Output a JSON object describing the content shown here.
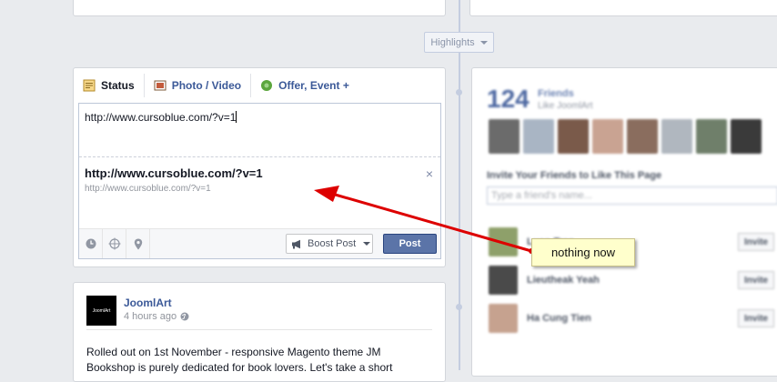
{
  "highlights": {
    "label": "Highlights"
  },
  "composer": {
    "tabs": [
      {
        "label": "Status",
        "icon": "status-icon"
      },
      {
        "label": "Photo / Video",
        "icon": "camera-icon"
      },
      {
        "label": "Offer, Event +",
        "icon": "offer-icon"
      }
    ],
    "input_value": "http://www.cursoblue.com/?v=1",
    "preview": {
      "title": "http://www.cursoblue.com/?v=1",
      "url": "http://www.cursoblue.com/?v=1",
      "close": "×"
    },
    "toolbar": {
      "icons": [
        "clock-icon",
        "target-icon",
        "location-pin-icon"
      ],
      "boost_label": "Boost Post",
      "post_label": "Post"
    }
  },
  "post": {
    "author": "JoomlArt",
    "time": "4 hours ago",
    "logo_text": "JoomlArt",
    "text": "Rolled out on 1st November - responsive Magento theme JM Bookshop is purely dedicated for book lovers. Let's take a short"
  },
  "sidebar": {
    "friends_count": "124",
    "friends_label": "Friends",
    "friends_sub": "Like JoomlArt",
    "invite_title": "Invite Your Friends to Like This Page",
    "invite_placeholder": "Type a friend's name...",
    "friends": [
      {
        "name": "Luan Tran",
        "button": "Invite"
      },
      {
        "name": "Lieutheak Yeah",
        "button": "Invite"
      },
      {
        "name": "Ha Cung Tien",
        "button": "Invite"
      }
    ]
  },
  "annotation": {
    "text": "nothing now"
  },
  "colors": {
    "link": "#3b5998",
    "post_button": "#5b74a8",
    "note_bg": "#ffffcc",
    "arrow": "#dd0000"
  }
}
